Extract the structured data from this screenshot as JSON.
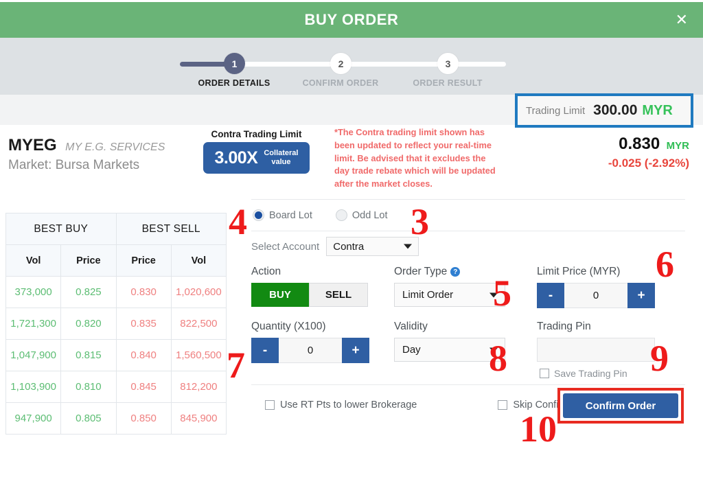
{
  "header": {
    "title": "BUY ORDER",
    "close_label": "✕"
  },
  "stepper": {
    "steps": [
      {
        "num": "1",
        "label": "ORDER DETAILS",
        "active": true
      },
      {
        "num": "2",
        "label": "CONFIRM ORDER",
        "active": false
      },
      {
        "num": "3",
        "label": "ORDER RESULT",
        "active": false
      }
    ]
  },
  "trading_limit": {
    "label": "Trading Limit",
    "value": "300.00",
    "currency": "MYR",
    "highlight_color": "#1f7ac0"
  },
  "stock": {
    "code": "MYEG",
    "name": "MY E.G. SERVICES",
    "market": "Market: Bursa Markets"
  },
  "contra": {
    "title": "Contra Trading Limit",
    "multiplier": "3.00X",
    "sub_line1": "Collateral",
    "sub_line2": "value",
    "box_color": "#2e5fa3"
  },
  "note": {
    "text": "*The Contra trading limit shown has been updated to reflect your real-time limit. Be advised that it excludes the day trade rebate which will be updated after the market closes.",
    "color": "#f06a6a"
  },
  "price": {
    "last": "0.830",
    "currency": "MYR",
    "change": "-0.025 (-2.92%)",
    "change_color": "#e8453c"
  },
  "order_book": {
    "group_headers": [
      "BEST BUY",
      "BEST SELL"
    ],
    "columns": [
      "Vol",
      "Price",
      "Price",
      "Vol"
    ],
    "rows": [
      {
        "buy_vol": "373,000",
        "buy_price": "0.825",
        "sell_price": "0.830",
        "sell_vol": "1,020,600"
      },
      {
        "buy_vol": "1,721,300",
        "buy_price": "0.820",
        "sell_price": "0.835",
        "sell_vol": "822,500"
      },
      {
        "buy_vol": "1,047,900",
        "buy_price": "0.815",
        "sell_price": "0.840",
        "sell_vol": "1,560,500"
      },
      {
        "buy_vol": "1,103,900",
        "buy_price": "0.810",
        "sell_price": "0.845",
        "sell_vol": "812,200"
      },
      {
        "buy_vol": "947,900",
        "buy_price": "0.805",
        "sell_price": "0.850",
        "sell_vol": "845,900"
      }
    ],
    "buy_color": "#5cbd73",
    "sell_color": "#ef8080"
  },
  "form": {
    "lot_type": {
      "board_lot": "Board Lot",
      "odd_lot": "Odd Lot",
      "selected": "Board Lot"
    },
    "account": {
      "label": "Select Account",
      "value": "Contra"
    },
    "action": {
      "label": "Action",
      "buy": "BUY",
      "sell": "SELL",
      "selected": "BUY"
    },
    "order_type": {
      "label": "Order Type",
      "help_icon": "question-mark-icon",
      "value": "Limit Order"
    },
    "limit_price": {
      "label": "Limit Price (MYR)",
      "minus": "-",
      "value": "0",
      "plus": "+"
    },
    "quantity": {
      "label": "Quantity (X100)",
      "minus": "-",
      "value": "0",
      "plus": "+"
    },
    "validity": {
      "label": "Validity",
      "value": "Day"
    },
    "trading_pin": {
      "label": "Trading Pin",
      "value": "",
      "save_label": "Save Trading Pin",
      "save_checked": false
    },
    "use_rt_pts": {
      "label": "Use RT Pts to lower Brokerage",
      "checked": false
    },
    "skip_confirmation": {
      "label": "Skip Confirmation",
      "checked": false
    },
    "confirm_button": {
      "label": "Confirm Order",
      "highlight_color": "#e82b21"
    }
  },
  "annotations": {
    "a3": "3",
    "a4": "4",
    "a5": "5",
    "a6": "6",
    "a7": "7",
    "a8": "8",
    "a9": "9",
    "a10": "10",
    "color": "#ee1b1b"
  }
}
